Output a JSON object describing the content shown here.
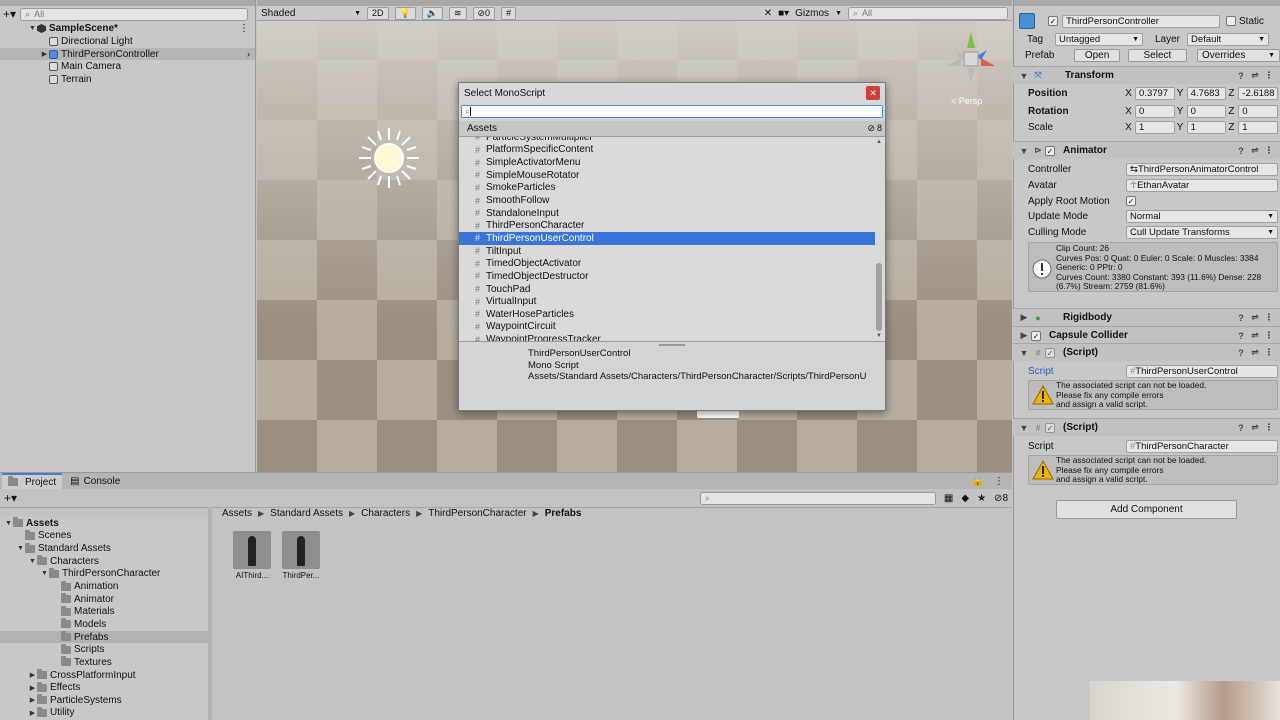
{
  "hierarchy": {
    "search_placeholder": "All",
    "scene": "SampleScene*",
    "items": [
      {
        "label": "Directional Light"
      },
      {
        "label": "ThirdPersonController"
      },
      {
        "label": "Main Camera"
      },
      {
        "label": "Terrain"
      }
    ]
  },
  "scene_toolbar": {
    "shading": "Shaded",
    "mode_2d": "2D",
    "hidden_count": "0",
    "gizmos": "Gizmos",
    "search_placeholder": "All",
    "persp": "< Persp"
  },
  "modal": {
    "title": "Select MonoScript",
    "search_value": "",
    "tab": "Assets",
    "hidden_count": "8",
    "items": [
      "ParticleSystemMultiplier",
      "PlatformSpecificContent",
      "SimpleActivatorMenu",
      "SimpleMouseRotator",
      "SmokeParticles",
      "SmoothFollow",
      "StandaloneInput",
      "ThirdPersonCharacter",
      "ThirdPersonUserControl",
      "TiltInput",
      "TimedObjectActivator",
      "TimedObjectDestructor",
      "TouchPad",
      "VirtualInput",
      "WaterHoseParticles",
      "WaypointCircuit",
      "WaypointProgressTracker"
    ],
    "selected_index": 8,
    "details": {
      "name": "ThirdPersonUserControl",
      "type": "Mono Script",
      "path": "Assets/Standard Assets/Characters/ThirdPersonCharacter/Scripts/ThirdPersonU"
    }
  },
  "project": {
    "tabs": [
      "Project",
      "Console"
    ],
    "hidden_count": "8",
    "tree": [
      {
        "label": "Assets",
        "depth": 0,
        "open": true,
        "bold": true
      },
      {
        "label": "Scenes",
        "depth": 1,
        "open": null
      },
      {
        "label": "Standard Assets",
        "depth": 1,
        "open": true
      },
      {
        "label": "Characters",
        "depth": 2,
        "open": true
      },
      {
        "label": "ThirdPersonCharacter",
        "depth": 3,
        "open": true
      },
      {
        "label": "Animation",
        "depth": 4,
        "open": null
      },
      {
        "label": "Animator",
        "depth": 4,
        "open": null
      },
      {
        "label": "Materials",
        "depth": 4,
        "open": null
      },
      {
        "label": "Models",
        "depth": 4,
        "open": null
      },
      {
        "label": "Prefabs",
        "depth": 4,
        "open": null,
        "selected": true
      },
      {
        "label": "Scripts",
        "depth": 4,
        "open": null
      },
      {
        "label": "Textures",
        "depth": 4,
        "open": null
      },
      {
        "label": "CrossPlatformInput",
        "depth": 2,
        "open": false
      },
      {
        "label": "Effects",
        "depth": 2,
        "open": false
      },
      {
        "label": "ParticleSystems",
        "depth": 2,
        "open": false
      },
      {
        "label": "Utility",
        "depth": 2,
        "open": false
      }
    ],
    "breadcrumb": [
      "Assets",
      "Standard Assets",
      "Characters",
      "ThirdPersonCharacter",
      "Prefabs"
    ],
    "prefabs": [
      "AIThird...",
      "ThirdPer..."
    ]
  },
  "inspector": {
    "object_name": "ThirdPersonController",
    "static_label": "Static",
    "tag_label": "Tag",
    "tag_value": "Untagged",
    "layer_label": "Layer",
    "layer_value": "Default",
    "prefab_label": "Prefab",
    "open_label": "Open",
    "select_label": "Select",
    "overrides_label": "Overrides",
    "transform": {
      "title": "Transform",
      "position_label": "Position",
      "rotation_label": "Rotation",
      "scale_label": "Scale",
      "position": [
        "0.3797",
        "4.7683",
        "-2.6188"
      ],
      "rotation": [
        "0",
        "0",
        "0"
      ],
      "scale": [
        "1",
        "1",
        "1"
      ]
    },
    "animator": {
      "title": "Animator",
      "controller_label": "Controller",
      "controller_value": "ThirdPersonAnimatorControl",
      "avatar_label": "Avatar",
      "avatar_value": "EthanAvatar",
      "root_motion_label": "Apply Root Motion",
      "update_mode_label": "Update Mode",
      "update_mode_value": "Normal",
      "culling_label": "Culling Mode",
      "culling_value": "Cull Update Transforms",
      "info": [
        "Clip Count: 26",
        "Curves Pos: 0 Quat: 0 Euler: 0 Scale: 0 Muscles: 3384",
        "Generic: 0 PPtr: 0",
        "Curves Count: 3380 Constant: 393 (11.6%) Dense: 228",
        "(6.7%) Stream: 2759 (81.6%)"
      ]
    },
    "rigidbody_title": "Rigidbody",
    "capsule_title": "Capsule Collider",
    "script1": {
      "title": "(Script)",
      "label": "Script",
      "value": "ThirdPersonUserControl",
      "warning": [
        "The associated script can not be loaded.",
        "Please fix any compile errors",
        "and assign a valid script."
      ]
    },
    "script2": {
      "title": "(Script)",
      "label": "Script",
      "value": "ThirdPersonCharacter",
      "warning": [
        "The associated script can not be loaded.",
        "Please fix any compile errors",
        "and assign a valid script."
      ]
    },
    "add_component": "Add Component"
  }
}
